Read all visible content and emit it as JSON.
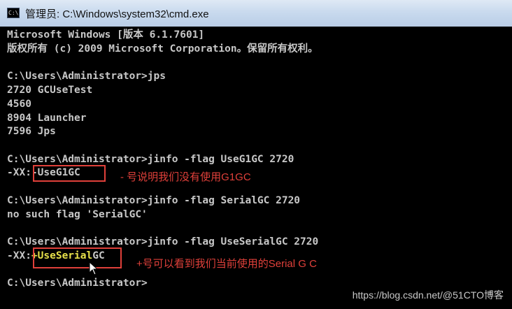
{
  "window": {
    "title": "管理员: C:\\Windows\\system32\\cmd.exe",
    "icon_text": "C:\\."
  },
  "console": {
    "lines": [
      "Microsoft Windows [版本 6.1.7601]",
      "版权所有 (c) 2009 Microsoft Corporation。保留所有权利。",
      "",
      "C:\\Users\\Administrator>jps",
      "2720 GCUseTest",
      "4560",
      "8904 Launcher",
      "7596 Jps",
      "",
      "C:\\Users\\Administrator>jinfo -flag UseG1GC 2720",
      "-XX:-UseG1GC",
      "",
      "C:\\Users\\Administrator>jinfo -flag SerialGC 2720",
      "no such flag 'SerialGC'",
      "",
      "C:\\Users\\Administrator>jinfo -flag UseSerialGC 2720",
      "",
      "",
      "C:\\Users\\Administrator>"
    ],
    "serial_prefix": "-XX:",
    "serial_highlight": "+UseSerial",
    "serial_suffix": "GC"
  },
  "annotations": {
    "g1gc_note": "- 号说明我们没有使用G1GC",
    "serial_note": "+号可以看到我们当前使用的Serial G C"
  },
  "watermark": "https://blog.csdn.net/@51CTO博客",
  "colors": {
    "console_bg": "#000000",
    "console_text": "#c8c8c8",
    "highlight_text": "#e6e04a",
    "annotation_red": "#e0403a"
  },
  "icons": [
    "cmd-window-icon",
    "mouse-pointer-icon"
  ]
}
